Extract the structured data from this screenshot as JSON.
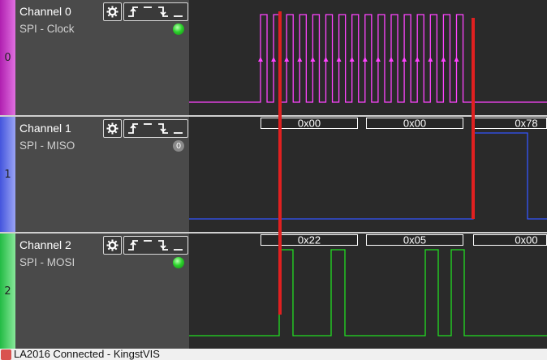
{
  "channels": [
    {
      "index": "0",
      "name": "Channel 0",
      "protocol": "SPI - Clock",
      "status": "active",
      "bar_color": "#cc33cc",
      "trace_color": "#ff44ff",
      "decode": []
    },
    {
      "index": "1",
      "name": "Channel 1",
      "protocol": "SPI - MISO",
      "status": "0",
      "bar_color": "#5566ee",
      "trace_color": "#3355ff",
      "decode": [
        "0x00",
        "0x00",
        "0x78"
      ]
    },
    {
      "index": "2",
      "name": "Channel 2",
      "protocol": "SPI - MOSI",
      "status": "active",
      "bar_color": "#33cc55",
      "trace_color": "#22dd22",
      "decode": [
        "0x22",
        "0x05",
        "0x00"
      ]
    }
  ],
  "icons": {
    "settings": "gear-icon",
    "rising": "rising-edge-icon",
    "high": "high-level-icon",
    "falling": "falling-edge-icon",
    "low": "low-level-icon"
  },
  "cursor_color": "#e02020",
  "taskbar": {
    "title": "LA2016 Connected - KingstVIS"
  }
}
